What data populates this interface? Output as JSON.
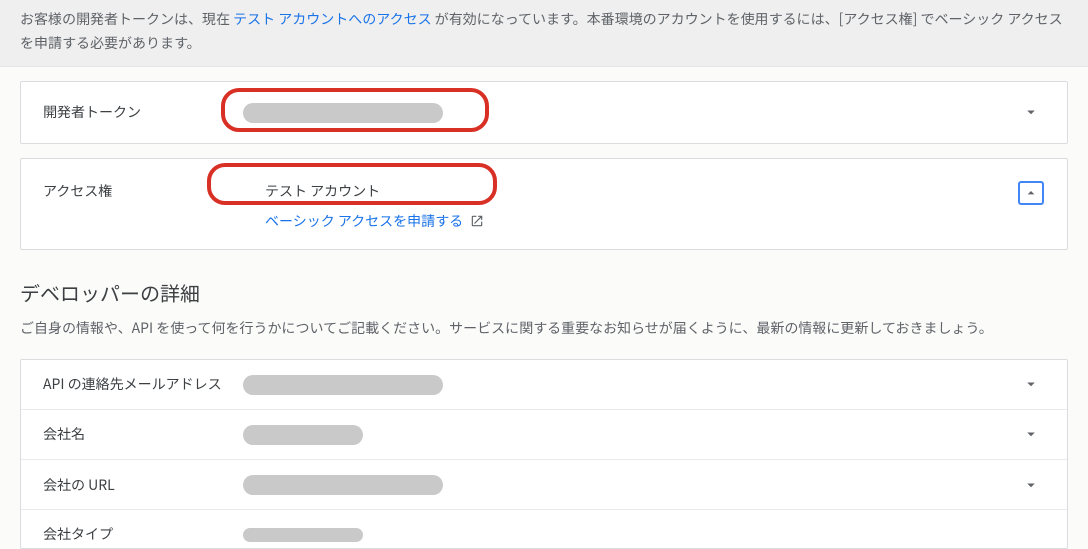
{
  "notice": {
    "prefix": "お客様の開発者トークンは、現在",
    "link_text": "テスト アカウントへのアクセス",
    "suffix": "が有効になっています。本番環境のアカウントを使用するには、[アクセス権] でベーシック アクセスを申請する必要があります。"
  },
  "rows_top": {
    "dev_token_label": "開発者トークン",
    "access_label": "アクセス権",
    "access_value": "テスト アカウント",
    "apply_basic_link": "ベーシック アクセスを申請する"
  },
  "section": {
    "title": "デベロッパーの詳細",
    "description": "ご自身の情報や、API を使って何を行うかについてご記載ください。サービスに関する重要なお知らせが届くように、最新の情報に更新しておきましょう。"
  },
  "rows_bottom": {
    "email_label": "API の連絡先メールアドレス",
    "company_label": "会社名",
    "company_url_label": "会社の URL",
    "company_type_label": "会社タイプ"
  }
}
